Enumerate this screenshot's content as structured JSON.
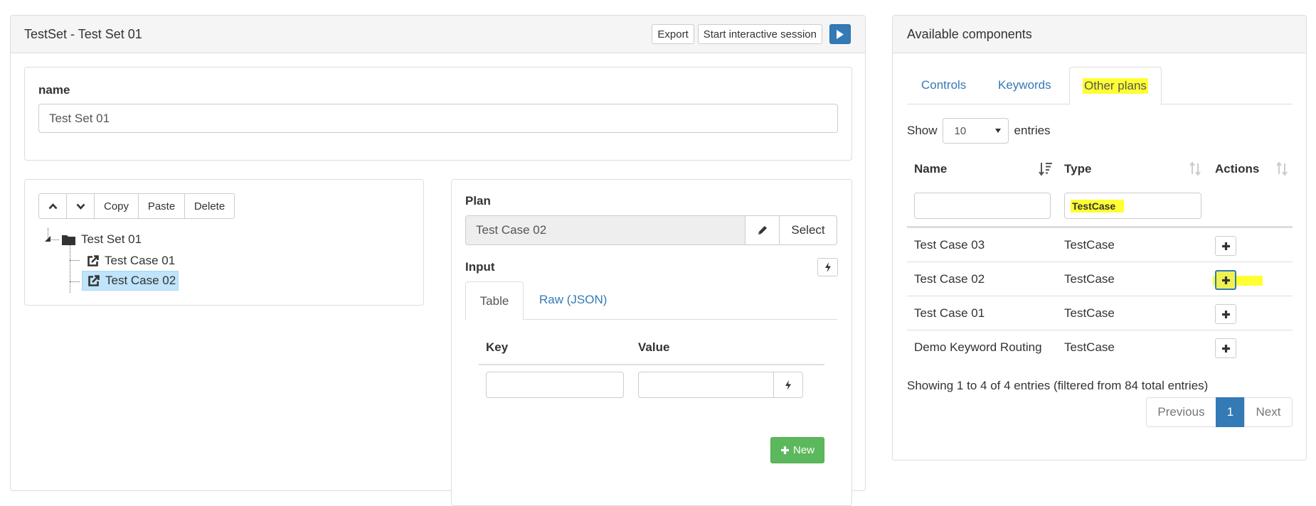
{
  "editor": {
    "title": "TestSet - Test Set 01",
    "export_label": "Export",
    "interactive_label": "Start interactive session",
    "play_icon": "play-icon"
  },
  "name_field": {
    "label": "name",
    "value": "Test Set 01"
  },
  "tree_toolbar": {
    "copy": "Copy",
    "paste": "Paste",
    "delete": "Delete"
  },
  "tree": {
    "root": "Test Set 01",
    "children": [
      "Test Case 01",
      "Test Case 02"
    ],
    "selected": "Test Case 02"
  },
  "plan": {
    "label": "Plan",
    "value": "Test Case 02",
    "select_label": "Select",
    "input_label": "Input",
    "tabs": [
      "Table",
      "Raw (JSON)"
    ],
    "active_tab": "Table",
    "col_key": "Key",
    "col_value": "Value",
    "new_label": "New"
  },
  "components": {
    "title": "Available components",
    "tabs": [
      "Controls",
      "Keywords",
      "Other plans"
    ],
    "active_tab": "Other plans",
    "show_label": "Show",
    "page_size": "10",
    "entries_label": "entries",
    "columns": [
      "Name",
      "Type",
      "Actions"
    ],
    "type_filter": "TestCase",
    "rows": [
      {
        "name": "Test Case 03",
        "type": "TestCase"
      },
      {
        "name": "Test Case 02",
        "type": "TestCase"
      },
      {
        "name": "Test Case 01",
        "type": "TestCase"
      },
      {
        "name": "Demo Keyword Routing",
        "type": "TestCase"
      }
    ],
    "info": "Showing 1 to 4 of 4 entries (filtered from 84 total entries)",
    "pagination": {
      "previous": "Previous",
      "current": "1",
      "next": "Next"
    }
  },
  "colors": {
    "primary": "#337ab7",
    "success": "#5cb85c",
    "highlight": "#ffff33",
    "selection": "#bfe4fb"
  }
}
